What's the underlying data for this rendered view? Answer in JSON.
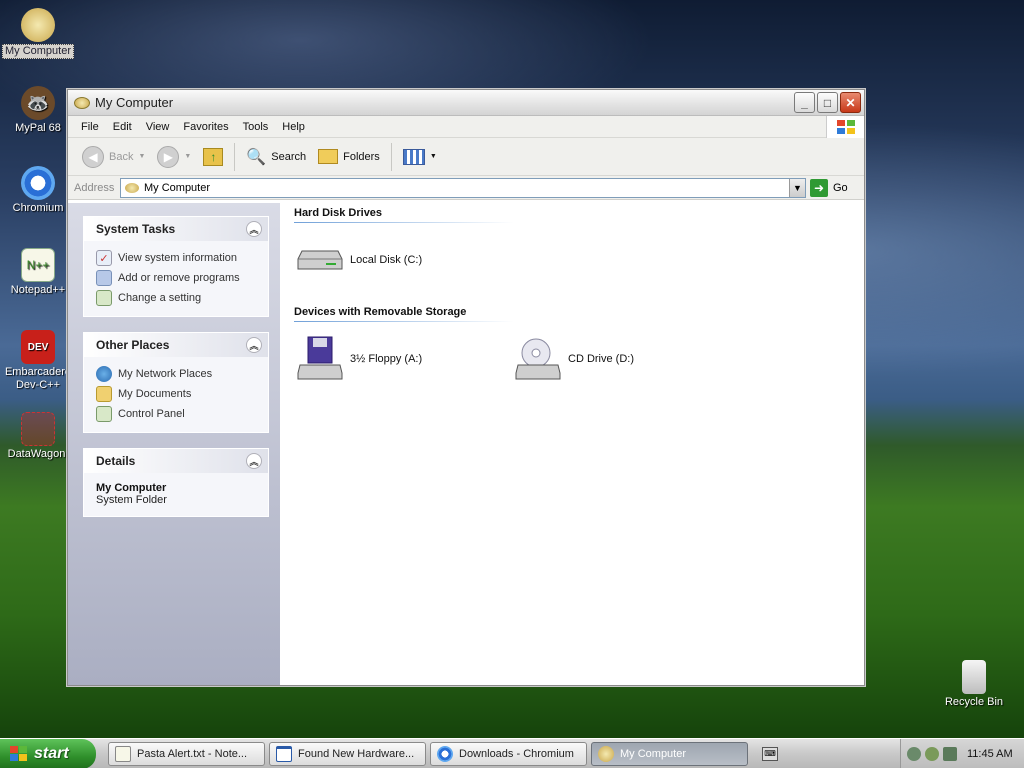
{
  "desktop": {
    "icons": [
      {
        "label": "My Computer",
        "icon": "my-computer-icon"
      },
      {
        "label": "MyPal 68",
        "icon": "mypal-icon"
      },
      {
        "label": "Chromium",
        "icon": "chromium-icon"
      },
      {
        "label": "Notepad++",
        "icon": "notepadpp-icon"
      },
      {
        "label": "Embarcadero Dev-C++",
        "icon": "devcpp-icon"
      },
      {
        "label": "DataWagon.",
        "icon": "datawagon-icon"
      },
      {
        "label": "Recycle Bin",
        "icon": "recycle-bin-icon"
      }
    ]
  },
  "window": {
    "title": "My Computer",
    "menu": [
      "File",
      "Edit",
      "View",
      "Favorites",
      "Tools",
      "Help"
    ],
    "toolbar": {
      "back": "Back",
      "search": "Search",
      "folders": "Folders"
    },
    "address": {
      "label": "Address",
      "value": "My Computer",
      "go": "Go"
    },
    "taskpane": {
      "system_tasks": {
        "title": "System Tasks",
        "items": [
          "View system information",
          "Add or remove programs",
          "Change a setting"
        ]
      },
      "other_places": {
        "title": "Other Places",
        "items": [
          "My Network Places",
          "My Documents",
          "Control Panel"
        ]
      },
      "details": {
        "title": "Details",
        "name": "My Computer",
        "type": "System Folder"
      }
    },
    "groups": {
      "hard_disks": {
        "title": "Hard Disk Drives",
        "drives": [
          "Local Disk (C:)"
        ]
      },
      "removable": {
        "title": "Devices with Removable Storage",
        "drives": [
          "3½ Floppy (A:)",
          "CD Drive (D:)"
        ]
      }
    }
  },
  "taskbar": {
    "start": "start",
    "tasks": [
      "Pasta Alert.txt - Note...",
      "Found New Hardware...",
      "Downloads - Chromium",
      "My Computer"
    ],
    "clock": "11:45 AM"
  }
}
